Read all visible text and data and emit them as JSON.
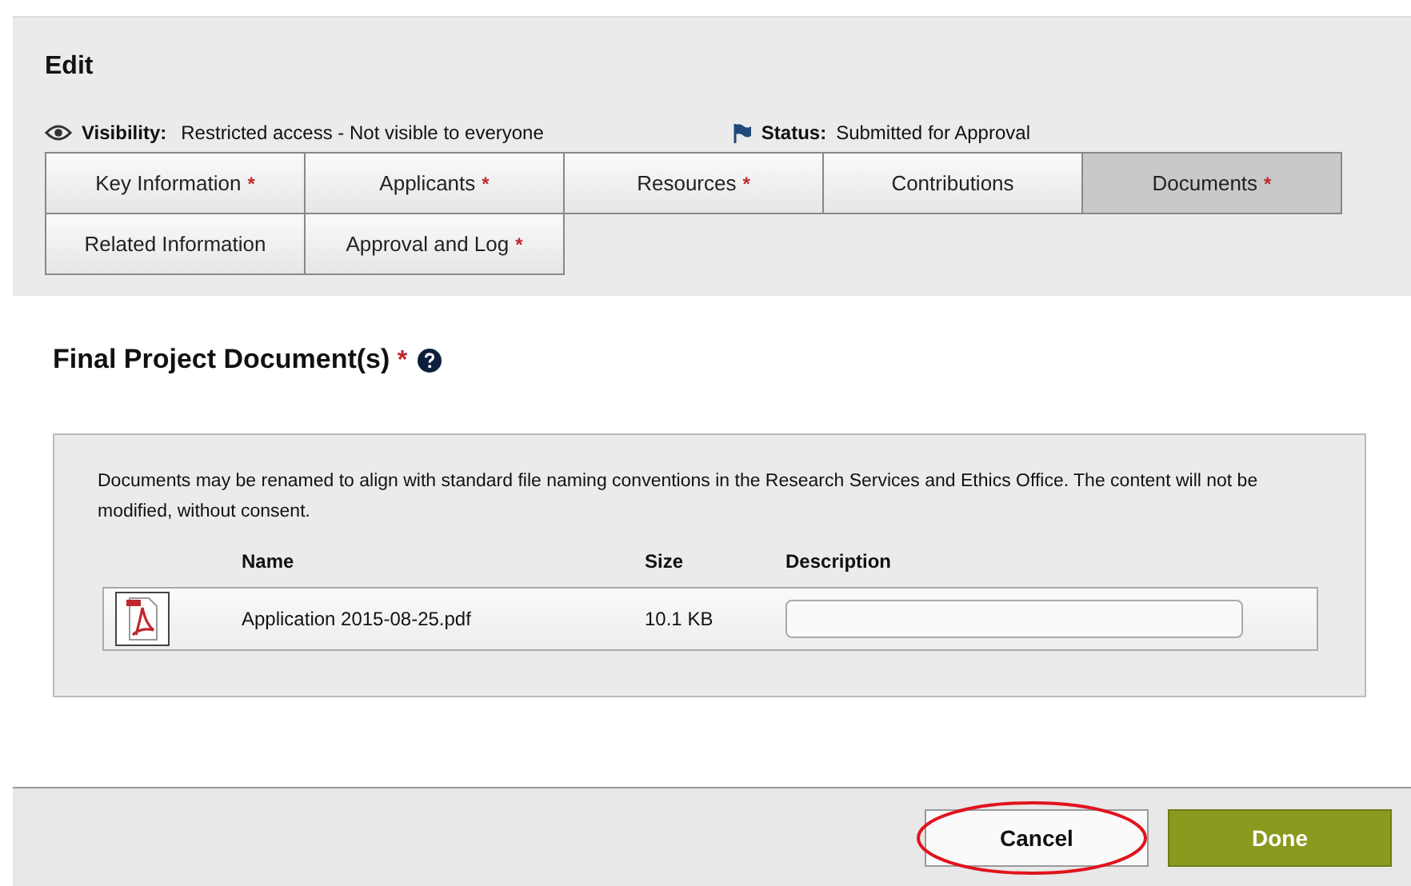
{
  "header": {
    "title": "Edit",
    "visibility": {
      "label": "Visibility:",
      "value": "Restricted access - Not visible to everyone"
    },
    "status": {
      "label": "Status:",
      "value": "Submitted for Approval"
    }
  },
  "tabs": [
    {
      "label": "Key Information",
      "marker": "*",
      "selected": false
    },
    {
      "label": "Applicants",
      "marker": "*",
      "selected": false
    },
    {
      "label": "Resources",
      "marker": "*",
      "selected": false
    },
    {
      "label": "Contributions",
      "selected": false
    },
    {
      "label": "Documents",
      "marker": "*",
      "selected": true
    },
    {
      "label": "Related Information",
      "selected": false
    },
    {
      "label": "Approval and Log",
      "marker": "*",
      "selected": false
    }
  ],
  "section": {
    "title": "Final Project Document(s)",
    "marker": "*",
    "help": true,
    "note": "Documents may be renamed to align with standard file naming conventions in the Research Services and Ethics Office. The content will not be modified, without consent.",
    "columns": [
      "Name",
      "Size",
      "Description"
    ],
    "files": [
      {
        "kind": "pdf",
        "name": "Application 2015-08-25.pdf",
        "size": "10.1 KB"
      }
    ]
  },
  "buttons": [
    {
      "label": "Cancel",
      "kind": "secondary",
      "circled": true
    },
    {
      "label": "Done",
      "kind": "primary",
      "circled": false
    }
  ]
}
